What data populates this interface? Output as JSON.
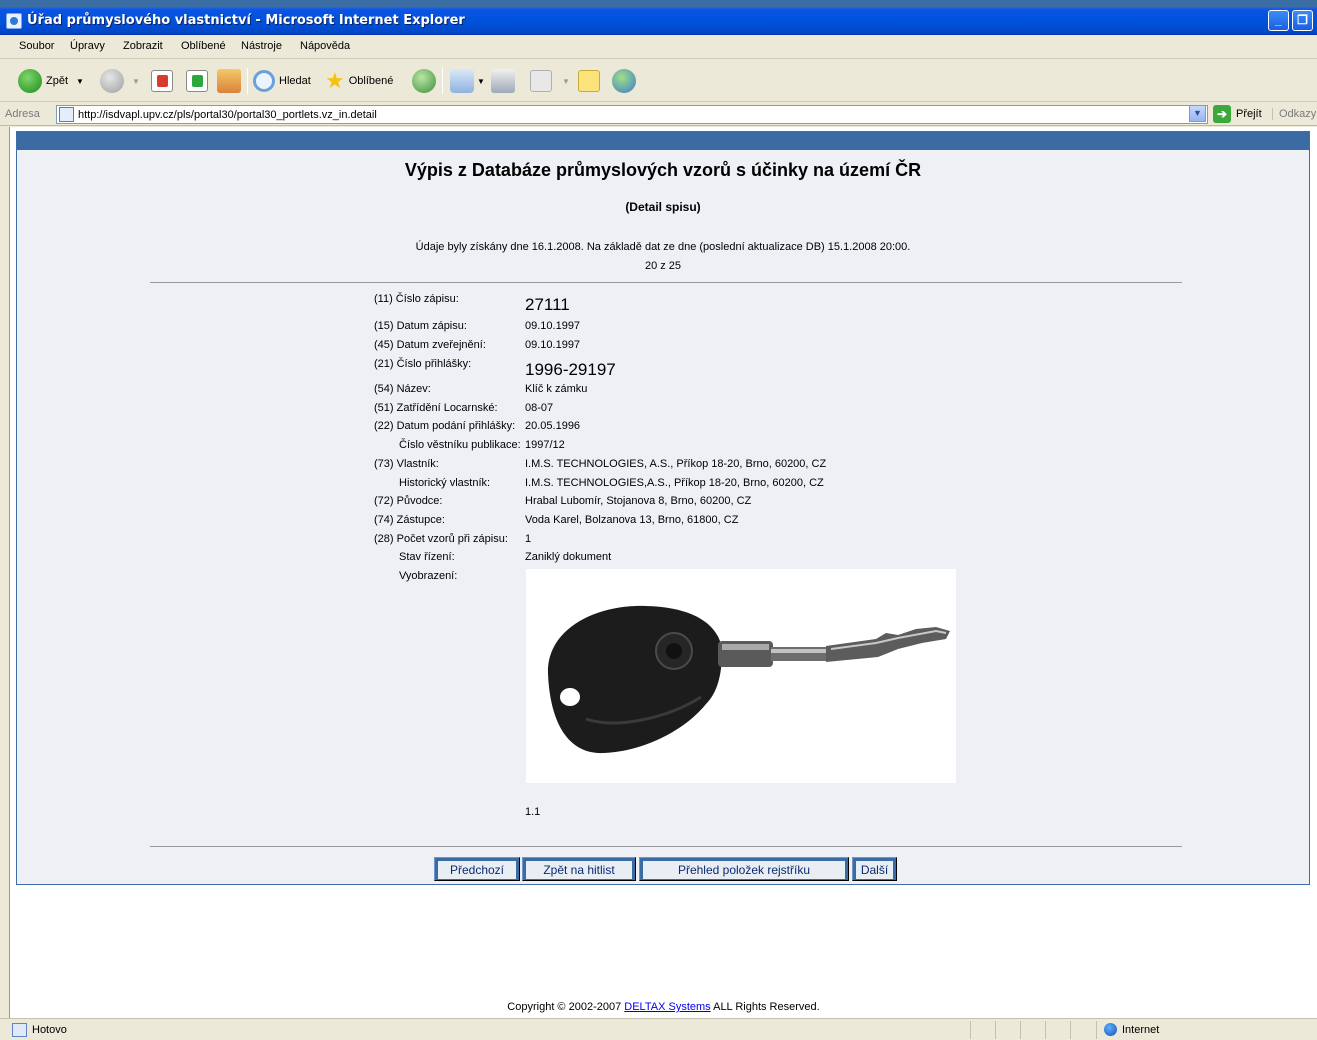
{
  "window": {
    "title": "Úřad průmyslového vlastnictví - Microsoft Internet Explorer",
    "controls": [
      "_",
      "❐"
    ]
  },
  "menu": [
    "Soubor",
    "Úpravy",
    "Zobrazit",
    "Oblíbené",
    "Nástroje",
    "Nápověda"
  ],
  "toolbar": {
    "back_label": "Zpět",
    "search_label": "Hledat",
    "favorites_label": "Oblíbené"
  },
  "address": {
    "label": "Adresa",
    "url": "http://isdvapl.upv.cz/pls/portal30/portal30_portlets.vz_in.detail",
    "go_label": "Přejít",
    "links_label": "Odkazy"
  },
  "page": {
    "title": "Výpis z Databáze průmyslových vzorů s účinky na území ČR",
    "subtitle": "(Detail spisu)",
    "info_line": "Údaje byly získány dne 16.1.2008. Na základě dat ze dne (poslední aktualizace DB) 15.1.2008 20:00.",
    "position": "20 z 25",
    "fields": [
      {
        "label": "(11) Číslo zápisu:",
        "value": "27111"
      },
      {
        "label": "(15) Datum zápisu:",
        "value": "09.10.1997"
      },
      {
        "label": "(45) Datum zveřejnění:",
        "value": "09.10.1997"
      },
      {
        "label": "(21) Číslo přihlášky:",
        "value": "1996-29197"
      },
      {
        "label": "(54) Název:",
        "value": "Klíč k zámku"
      },
      {
        "label": "(51) Zatřídění Locarnské:",
        "value": "08-07"
      },
      {
        "label": "(22) Datum podání přihlášky:",
        "value": "20.05.1996"
      },
      {
        "label": "Číslo věstníku publikace:",
        "value": "1997/12"
      },
      {
        "label": "(73) Vlastník:",
        "value": "I.M.S. TECHNOLOGIES, A.S., Příkop 18-20, Brno, 60200, CZ"
      },
      {
        "label": "Historický vlastník:",
        "value": "I.M.S. TECHNOLOGIES,A.S., Příkop 18-20, Brno, 60200, CZ"
      },
      {
        "label": "(72) Původce:",
        "value": "Hrabal Lubomír, Stojanova 8, Brno, 60200, CZ"
      },
      {
        "label": "(74) Zástupce:",
        "value": "Voda Karel, Bolzanova 13, Brno, 61800, CZ"
      },
      {
        "label": "(28) Počet vzorů při zápisu:",
        "value": "1"
      },
      {
        "label": "Stav řízení:",
        "value": "Zaniklý dokument"
      },
      {
        "label": "Vyobrazení:",
        "value": ""
      }
    ],
    "image_caption": "1.1",
    "buttons": {
      "prev": "Předchozí",
      "back": "Zpět na hitlist",
      "overview": "Přehled položek rejstříku",
      "next": "Další"
    },
    "copyright_prefix": "Copyright © 2002-2007 ",
    "copyright_link": "DELTAX Systems",
    "copyright_suffix": " ALL Rights Reserved."
  },
  "status": {
    "text": "Hotovo",
    "zone": "Internet"
  }
}
